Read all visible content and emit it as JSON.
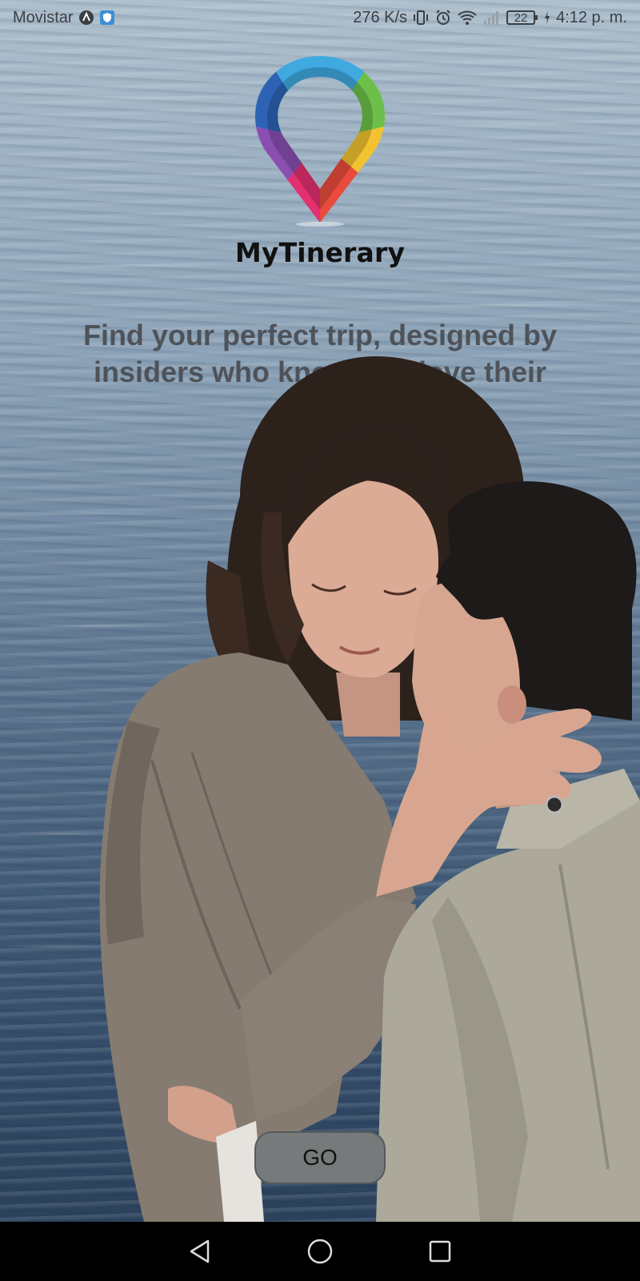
{
  "status_bar": {
    "carrier": "Movistar",
    "network_speed": "276 K/s",
    "battery": "22",
    "time": "4:12 p. m.",
    "icons": [
      "carrier-a-icon",
      "shield-icon",
      "vibrate-icon",
      "alarm-icon",
      "wifi-icon",
      "signal-icon",
      "battery-icon",
      "charging-icon"
    ]
  },
  "app": {
    "name": "MyTinerary",
    "logo_icon": "map-pin-logo",
    "tagline": "Find your perfect trip, designed by insiders who know and love their cities!"
  },
  "go_button": {
    "label": "GO"
  },
  "nav_bar": {
    "icons": [
      "back-icon",
      "home-icon",
      "recents-icon"
    ]
  },
  "colors": {
    "go_button_bg": "#777a7b",
    "logo_segments": [
      "#3fa9e0",
      "#6cc04a",
      "#f2c230",
      "#e94b3c",
      "#e3306f",
      "#8a4fb1",
      "#2d62b5"
    ]
  }
}
